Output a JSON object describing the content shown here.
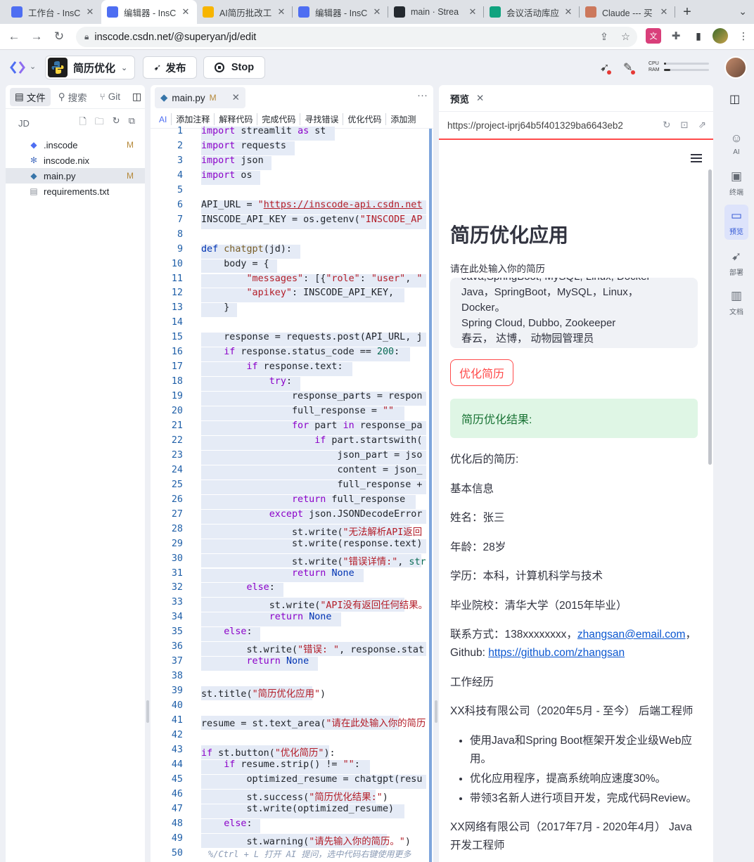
{
  "browser": {
    "tabs": [
      {
        "title": "工作台 - InsC",
        "color": "#4e6ef2"
      },
      {
        "title": "编辑器 - InsC",
        "color": "#4e6ef2",
        "active": true
      },
      {
        "title": "AI简历批改工",
        "color": "#f7b500"
      },
      {
        "title": "编辑器 - InsC",
        "color": "#4e6ef2"
      },
      {
        "title": "main · Strea",
        "color": "#24292f"
      },
      {
        "title": "会议活动库应",
        "color": "#10a37f"
      },
      {
        "title": "Claude --- 买",
        "color": "#cc785c"
      }
    ],
    "url": "inscode.csdn.net/@superyan/jd/edit"
  },
  "appbar": {
    "project": "简历优化",
    "publish": "发布",
    "stop": "Stop",
    "cpu_label": "CPU",
    "ram_label": "RAM",
    "cpu": 0.05,
    "ram": 0.15
  },
  "sidebar": {
    "tabs": [
      "文件",
      "搜索",
      "Git"
    ],
    "root": "JD",
    "files": [
      {
        "name": ".inscode",
        "badge": "M",
        "icon": "inscode-icon"
      },
      {
        "name": "inscode.nix",
        "badge": "",
        "icon": "nix-icon"
      },
      {
        "name": "main.py",
        "badge": "M",
        "icon": "python-icon",
        "selected": true
      },
      {
        "name": "requirements.txt",
        "badge": "",
        "icon": "text-file-icon"
      }
    ]
  },
  "editor": {
    "tab_name": "main.py",
    "tab_badge": "M",
    "ai_actions": [
      "AI",
      "添加注释",
      "解释代码",
      "完成代码",
      "寻找错误",
      "优化代码",
      "添加测"
    ],
    "hint": "%/Ctrl + L 打开 AI 提问，选中代码右键使用更多"
  },
  "preview": {
    "tab": "预览",
    "url": "https://project-iprj64b5f401329ba6643eb2",
    "title": "简历优化应用",
    "input_label": "请在此处输入你的简历",
    "textarea_lines": [
      "Java,SpringBoot, MySQL, Linux, Docker",
      "Java，SpringBoot，MySQL，Linux，",
      "Docker。",
      "Spring Cloud, Dubbo, Zookeeper",
      "春云， 达博， 动物园管理员"
    ],
    "button": "优化简历",
    "success": "简历优化结果:",
    "output": {
      "heading": "优化后的简历:",
      "basic": "基本信息",
      "name": "姓名：张三",
      "age": "年龄：28岁",
      "edu": "学历：本科，计算机科学与技术",
      "school": "毕业院校：清华大学（2015年毕业）",
      "contact_prefix": "联系方式：138xxxxxxxx，",
      "email": "zhangsan@email.com",
      "contact_mid": "，",
      "github_prefix": "Github: ",
      "github": "https://github.com/zhangsan",
      "work": "工作经历",
      "job1": "XX科技有限公司（2020年5月 - 至今） 后端工程师",
      "bullets": [
        "使用Java和Spring Boot框架开发企业级Web应用。",
        "优化应用程序，提高系统响应速度30%。",
        "带领3名新人进行项目开发，完成代码Review。"
      ],
      "job2": "XX网络有限公司（2017年7月 - 2020年4月） Java开发工程师"
    }
  },
  "rightbar": [
    {
      "label": "AI",
      "icon": "robot-icon"
    },
    {
      "label": "终端",
      "icon": "terminal-icon"
    },
    {
      "label": "预览",
      "icon": "monitor-icon",
      "active": true
    },
    {
      "label": "部署",
      "icon": "rocket-icon"
    },
    {
      "label": "文档",
      "icon": "book-icon"
    }
  ]
}
